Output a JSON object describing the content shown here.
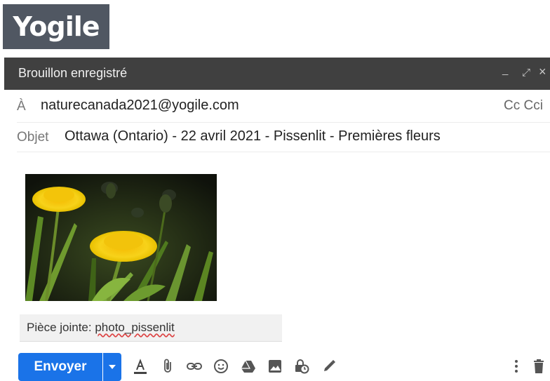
{
  "brand": {
    "logo_text": "Yogile"
  },
  "window": {
    "title": "Brouillon enregistré",
    "minimize_glyph": "_",
    "expand_glyph": "⤢",
    "close_glyph": "×"
  },
  "compose": {
    "to_label": "À",
    "to_value": "naturecanada2021@yogile.com",
    "cc_label": "Cc Cci",
    "subject_label": "Objet",
    "subject_value": "Ottawa (Ontario) - 22 avril 2021 - Pissenlit - Premières fleurs"
  },
  "attachment": {
    "label": "Pièce jointe: ",
    "filename": "photo_pissenlit"
  },
  "toolbar": {
    "send_label": "Envoyer",
    "icons": [
      "text-format-icon",
      "attach-icon",
      "link-icon",
      "emoji-icon",
      "drive-icon",
      "image-icon",
      "confidential-icon",
      "signature-icon",
      "more-options-icon",
      "trash-icon"
    ]
  },
  "colors": {
    "title_bar": "#404040",
    "send_button": "#1a73e8",
    "logo_bg": "#505762"
  }
}
